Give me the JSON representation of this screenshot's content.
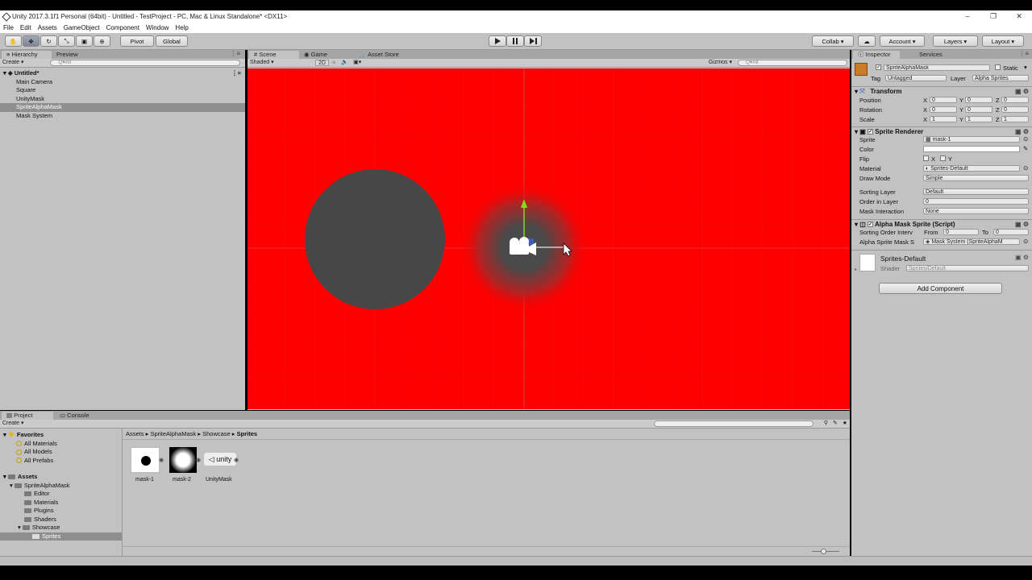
{
  "window": {
    "title": "Unity 2017.3.1f1 Personal (64bit) - Untitled - TestProject - PC, Mac & Linux Standalone* <DX11>",
    "controls": [
      "–",
      "❐",
      "✕"
    ]
  },
  "menu": [
    "File",
    "Edit",
    "Assets",
    "GameObject",
    "Component",
    "Window",
    "Help"
  ],
  "toolbar": {
    "pivot": "Pivot",
    "global": "Global",
    "collab": "Collab ▾",
    "account": "Account",
    "layers": "Layers",
    "layout": "Layout"
  },
  "hierarchy": {
    "tabs": [
      "Hierarchy",
      "Preview"
    ],
    "create": "Create ▾",
    "search_placeholder": "Q▾All",
    "scene_name": "Untitled*",
    "items": [
      "Main Camera",
      "Square",
      "UnityMask",
      "SpriteAlphaMask",
      "Mask System"
    ],
    "selected": "SpriteAlphaMask"
  },
  "scene": {
    "tabs": [
      "Scene",
      "Game",
      "Asset Store"
    ],
    "shading": "Shaded",
    "mode_2d": "2D",
    "gizmos": "Gizmos ▾",
    "search_placeholder": "Q▾All",
    "colors": {
      "background": "#fe0000",
      "circle": "#474747"
    }
  },
  "inspector": {
    "tabs": [
      "Inspector",
      "Services"
    ],
    "object_name": "SpriteAlphaMask",
    "static_label": "Static",
    "tag_label": "Tag",
    "tag_value": "Untagged",
    "layer_label": "Layer",
    "layer_value": "Alpha Sprites",
    "transform": {
      "title": "Transform",
      "rows": [
        {
          "label": "Position",
          "x": "0",
          "y": "0",
          "z": "0"
        },
        {
          "label": "Rotation",
          "x": "0",
          "y": "0",
          "z": "0"
        },
        {
          "label": "Scale",
          "x": "1",
          "y": "1",
          "z": "1"
        }
      ]
    },
    "sprite_renderer": {
      "title": "Sprite Renderer",
      "sprite_label": "Sprite",
      "sprite_value": "mask-1",
      "color_label": "Color",
      "flip_label": "Flip",
      "flip_x": "X",
      "flip_y": "Y",
      "material_label": "Material",
      "material_value": "Sprites-Default",
      "drawmode_label": "Draw Mode",
      "drawmode_value": "Simple",
      "sortlayer_label": "Sorting Layer",
      "sortlayer_value": "Default",
      "order_label": "Order in Layer",
      "order_value": "0",
      "maskint_label": "Mask Interaction",
      "maskint_value": "None"
    },
    "alpha_mask": {
      "title": "Alpha Mask Sprite (Script)",
      "sort_label": "Sorting Order Interv",
      "from_label": "From",
      "from_value": "0",
      "to_label": "To",
      "to_value": "0",
      "system_label": "Alpha Sprite Mask S",
      "system_value": "Mask System (SpriteAlphaM"
    },
    "material": {
      "name": "Sprites-Default",
      "shader_label": "Shader",
      "shader_value": "Sprites/Default"
    },
    "add_component": "Add Component"
  },
  "project": {
    "tabs": [
      "Project",
      "Console"
    ],
    "create": "Create ▾",
    "favorites_title": "Favorites",
    "favorites": [
      "All Materials",
      "All Models",
      "All Prefabs"
    ],
    "assets_title": "Assets",
    "tree": [
      "SpriteAlphaMask",
      "Editor",
      "Materials",
      "Plugins",
      "Shaders",
      "Showcase",
      "Sprites"
    ],
    "breadcrumb": [
      "Assets",
      "SpriteAlphaMask",
      "Showcase",
      "Sprites"
    ],
    "files": [
      "mask-1",
      "mask-2",
      "UnityMask"
    ],
    "unity_thumb_text": "unity"
  }
}
